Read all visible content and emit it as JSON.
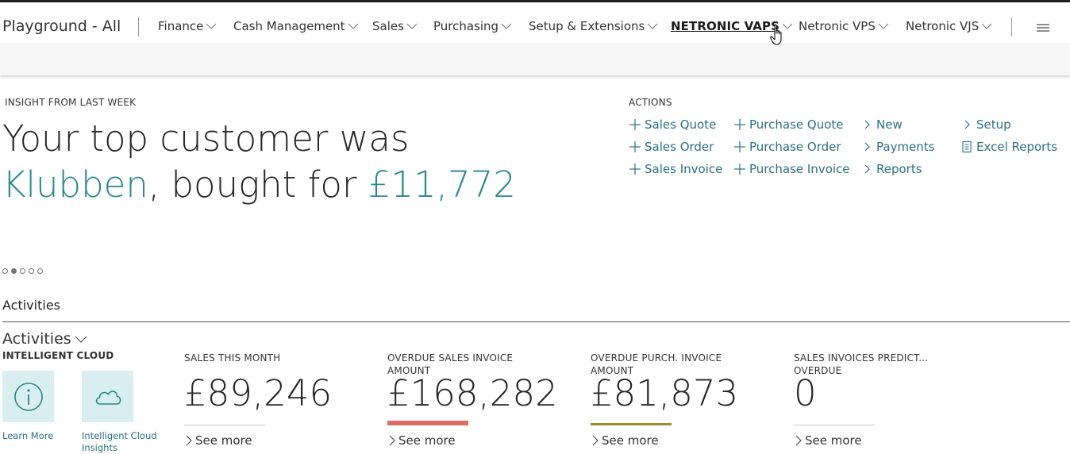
{
  "colors": {
    "accent": "#2a8787",
    "link": "#2d6f85",
    "overdue_red": "#dc6e63",
    "overdue_olive": "#9c8c2c",
    "tile_bg": "#d9eef1"
  },
  "navbar": {
    "brand": "Playground - All",
    "items": [
      {
        "label": "Finance"
      },
      {
        "label": "Cash Management"
      },
      {
        "label": "Sales"
      },
      {
        "label": "Purchasing"
      },
      {
        "label": "Setup & Extensions"
      },
      {
        "label": "NETRONIC VAPS",
        "active": true
      },
      {
        "label": "Netronic VPS"
      },
      {
        "label": "Netronic VJS"
      }
    ],
    "menu_icon": "hamburger-icon"
  },
  "insight": {
    "caption": "INSIGHT FROM LAST WEEK",
    "line1": "Your top customer was",
    "customer": "Klubben",
    "middle": ", bought for ",
    "amount": "£11,772",
    "carousel_total": 5,
    "carousel_active": 2
  },
  "actions": {
    "caption": "ACTIONS",
    "col1": [
      {
        "label": "Sales Quote",
        "icon": "plus-icon"
      },
      {
        "label": "Sales Order",
        "icon": "plus-icon"
      },
      {
        "label": "Sales Invoice",
        "icon": "plus-icon"
      }
    ],
    "col2": [
      {
        "label": "Purchase Quote",
        "icon": "plus-icon"
      },
      {
        "label": "Purchase Order",
        "icon": "plus-icon"
      },
      {
        "label": "Purchase Invoice",
        "icon": "plus-icon"
      }
    ],
    "col3": [
      {
        "label": "New",
        "icon": "chevron-right-icon"
      },
      {
        "label": "Payments",
        "icon": "chevron-right-icon"
      },
      {
        "label": "Reports",
        "icon": "chevron-right-icon"
      }
    ],
    "col4": [
      {
        "label": "Setup",
        "icon": "chevron-right-icon"
      },
      {
        "label": "Excel Reports",
        "icon": "document-icon"
      }
    ]
  },
  "activities": {
    "section_title": "Activities",
    "group_title": "Activities",
    "intelligent_cloud": {
      "caption": "INTELLIGENT CLOUD",
      "tiles": [
        {
          "label": "Learn More",
          "icon": "info-icon"
        },
        {
          "label": "Intelligent Cloud Insights",
          "icon": "cloud-icon"
        }
      ]
    },
    "cues": [
      {
        "caption": "SALES THIS MONTH",
        "value": "£89,246",
        "see_more": "See more"
      },
      {
        "caption": "OVERDUE SALES INVOICE AMOUNT",
        "value": "£168,282",
        "see_more": "See more"
      },
      {
        "caption": "OVERDUE PURCH. INVOICE AMOUNT",
        "value": "£81,873",
        "see_more": "See more"
      },
      {
        "caption": "SALES INVOICES PREDICT... OVERDUE",
        "value": "0",
        "see_more": "See more"
      }
    ]
  }
}
